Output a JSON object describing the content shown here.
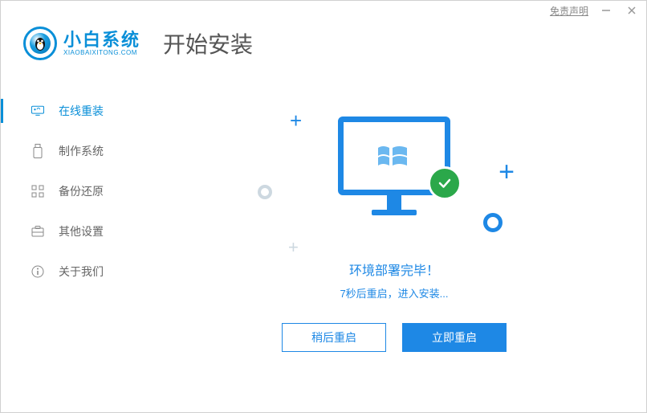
{
  "titlebar": {
    "disclaimer": "免责声明"
  },
  "logo": {
    "title": "小白系统",
    "subtitle": "XIAOBAIXITONG.COM"
  },
  "page_title": "开始安装",
  "sidebar": {
    "items": [
      {
        "label": "在线重装",
        "active": true
      },
      {
        "label": "制作系统",
        "active": false
      },
      {
        "label": "备份还原",
        "active": false
      },
      {
        "label": "其他设置",
        "active": false
      },
      {
        "label": "关于我们",
        "active": false
      }
    ]
  },
  "status": {
    "title": "环境部署完毕！",
    "subtitle": "7秒后重启，进入安装...",
    "countdown_seconds": 7
  },
  "buttons": {
    "later": "稍后重启",
    "now": "立即重启"
  },
  "colors": {
    "primary": "#1e88e5",
    "brand": "#0a8fd8",
    "success": "#2ba84a"
  }
}
